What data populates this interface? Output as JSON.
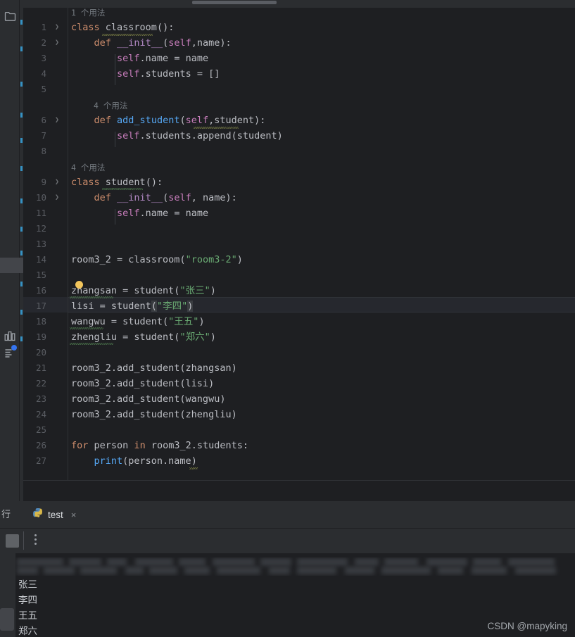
{
  "window": {
    "theme_bg": "#1e1f22",
    "panel_bg": "#2b2d30",
    "watermark": "CSDN @mapyking"
  },
  "sidebar": {
    "icons": [
      {
        "name": "project-folder-icon",
        "label": "项目"
      },
      {
        "name": "chart-icon",
        "label": "统计"
      },
      {
        "name": "notifications-icon",
        "label": "通知"
      }
    ]
  },
  "editor": {
    "language": "Python",
    "current_line": 17,
    "inlay_hints": [
      {
        "text": "1 个用法",
        "count": "1",
        "suffix": " 个用法",
        "at_line": 1
      },
      {
        "text": "4 个用法",
        "count": "4",
        "suffix": " 个用法",
        "at_line": 6
      },
      {
        "text": "4 个用法",
        "count": "4",
        "suffix": " 个用法",
        "at_line": 9
      }
    ],
    "lines": [
      {
        "n": 1,
        "text": "class classroom():"
      },
      {
        "n": 2,
        "text": "    def __init__(self,name):"
      },
      {
        "n": 3,
        "text": "        self.name = name"
      },
      {
        "n": 4,
        "text": "        self.students = []"
      },
      {
        "n": 5,
        "text": ""
      },
      {
        "n": 6,
        "text": "    def add_student(self,student):"
      },
      {
        "n": 7,
        "text": "        self.students.append(student)"
      },
      {
        "n": 8,
        "text": ""
      },
      {
        "n": 9,
        "text": "class student():"
      },
      {
        "n": 10,
        "text": "    def __init__(self, name):"
      },
      {
        "n": 11,
        "text": "        self.name = name"
      },
      {
        "n": 12,
        "text": ""
      },
      {
        "n": 13,
        "text": ""
      },
      {
        "n": 14,
        "text": "room3_2 = classroom(\"room3-2\")"
      },
      {
        "n": 15,
        "text": ""
      },
      {
        "n": 16,
        "text": "zhangsan = student(\"张三\")"
      },
      {
        "n": 17,
        "text": "lisi = student(\"李四\")"
      },
      {
        "n": 18,
        "text": "wangwu = student(\"王五\")"
      },
      {
        "n": 19,
        "text": "zhengliu = student(\"郑六\")"
      },
      {
        "n": 20,
        "text": ""
      },
      {
        "n": 21,
        "text": "room3_2.add_student(zhangsan)"
      },
      {
        "n": 22,
        "text": "room3_2.add_student(lisi)"
      },
      {
        "n": 23,
        "text": "room3_2.add_student(wangwu)"
      },
      {
        "n": 24,
        "text": "room3_2.add_student(zhengliu)"
      },
      {
        "n": 25,
        "text": ""
      },
      {
        "n": 26,
        "text": "for person in room3_2.students:"
      },
      {
        "n": 27,
        "text": "    print(person.name)"
      }
    ],
    "fold_markers": [
      1,
      2,
      6,
      9,
      10
    ],
    "tokens": {
      "keyword_class": "class",
      "keyword_def": "def",
      "keyword_for": "for",
      "keyword_in": "in",
      "self": "self",
      "dunder_init": "__init__",
      "fn_classroom": "classroom",
      "fn_student": "student",
      "fn_add_student": "add_student",
      "fn_append": "append",
      "fn_print": "print",
      "str_room": "\"room3-2\"",
      "str_zhangsan": "\"张三\"",
      "str_lisi": "\"李四\"",
      "str_wangwu": "\"王五\"",
      "str_zhengliu": "\"郑六\""
    },
    "colors": {
      "keyword": "#cf8e6d",
      "function": "#56a8f5",
      "self_param": "#c77dbb",
      "magic_method": "#b389c5",
      "string": "#6aab73",
      "default_text": "#bcbec4",
      "line_number": "#5a5d63",
      "inlay_hint": "#747a80"
    }
  },
  "run_panel": {
    "tool_label": "运行",
    "tool_label_visible": "行",
    "tab": {
      "icon": "python-file-icon",
      "label": "test",
      "close": "×"
    },
    "toolbar": {
      "stop_button": "stop-button",
      "more_button": "more-options-button"
    },
    "console": {
      "command_line": "(blurred)",
      "output": [
        "张三",
        "李四",
        "王五",
        "郑六"
      ]
    }
  }
}
